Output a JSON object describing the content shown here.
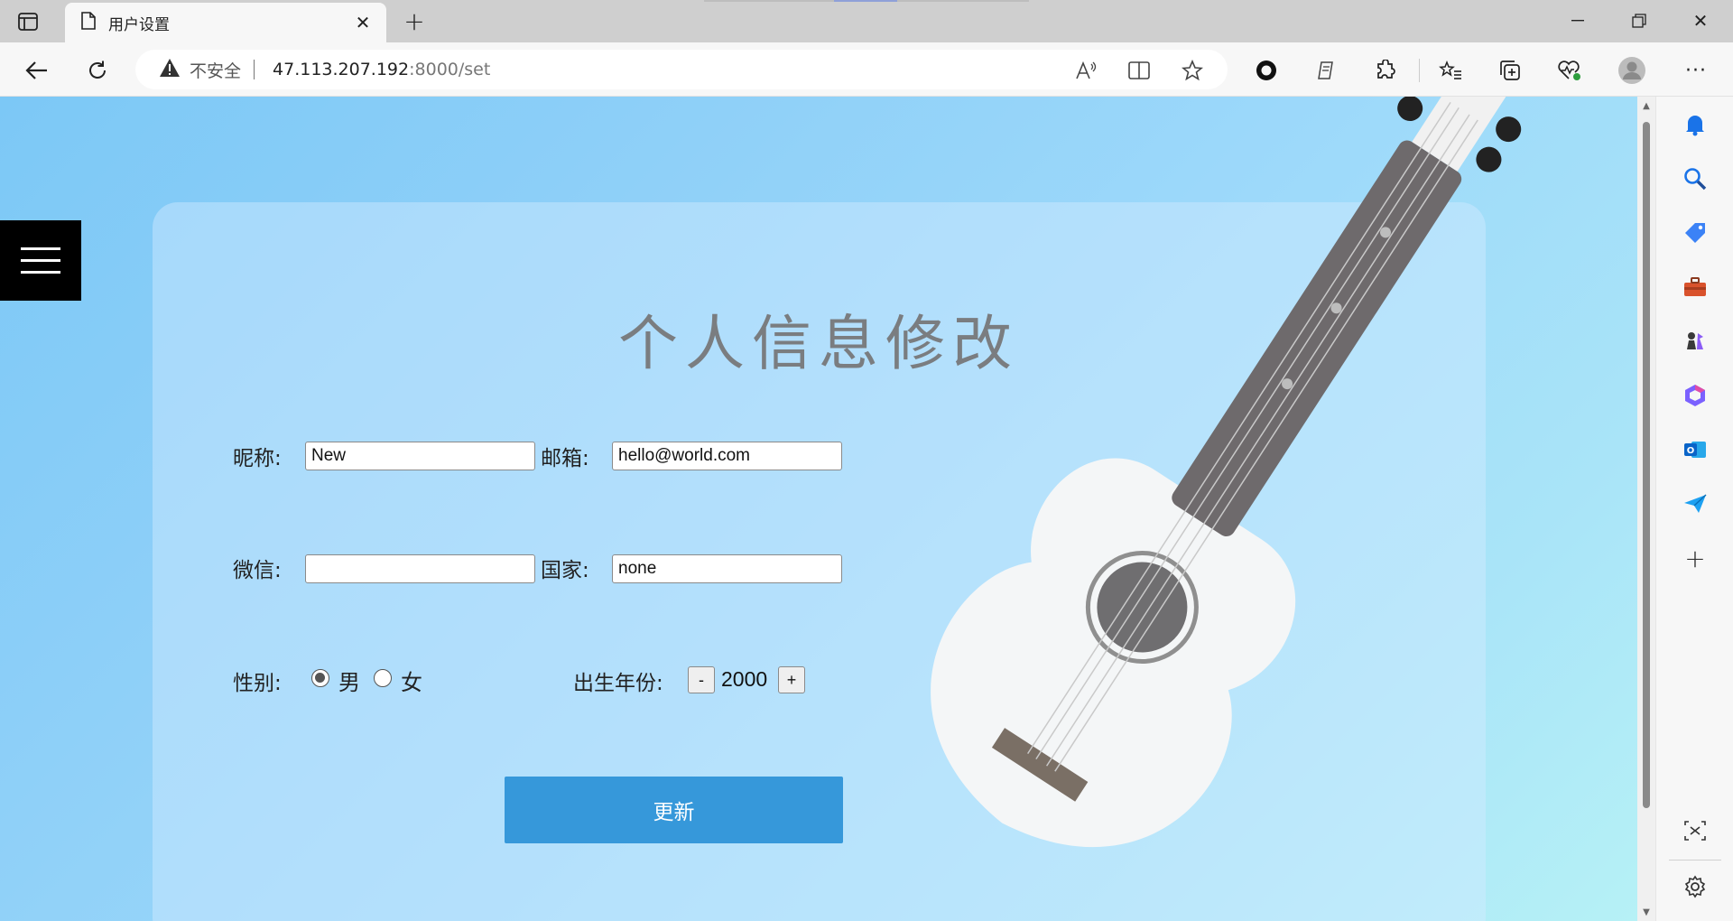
{
  "browser": {
    "tab_title": "用户设置",
    "insecure_label": "不安全",
    "url_host": "47.113.207.192",
    "url_path": ":8000/set"
  },
  "page": {
    "heading": "个人信息修改",
    "nickname_label": "昵称:",
    "nickname_value": "New",
    "email_label": "邮箱:",
    "email_value": "hello@world.com",
    "wechat_label": "微信:",
    "wechat_value": "",
    "country_label": "国家:",
    "country_value": "none",
    "gender_label": "性别:",
    "gender_options": [
      "男",
      "女"
    ],
    "gender_selected": "男",
    "birth_year_label": "出生年份:",
    "birth_year_minus": "-",
    "birth_year_value": "2000",
    "birth_year_plus": "+",
    "submit_label": "更新"
  },
  "colors": {
    "submit_button": "#3698da",
    "menu_button": "#000000",
    "heading": "#7a7d80"
  }
}
